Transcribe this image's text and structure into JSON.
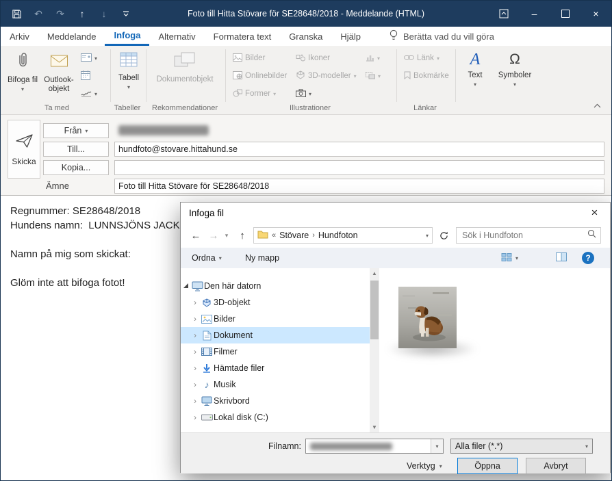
{
  "window": {
    "title": "Foto till Hitta Stövare för SE28648/2018 - Meddelande (HTML)"
  },
  "icons": {
    "dropdown": "▾",
    "undo": "↶",
    "redo": "↷",
    "prev_item": "↑",
    "next_item": "↓",
    "minimize": "–",
    "close": "×",
    "back": "←",
    "forward": "→",
    "up": "↑",
    "overflow": "«",
    "crumb_sep": "›",
    "tree_collapsed": "›",
    "music_note": "♪",
    "omega": "Ω",
    "text_a": "A",
    "help": "?"
  },
  "ribbon": {
    "tabs": [
      {
        "label": "Arkiv"
      },
      {
        "label": "Meddelande"
      },
      {
        "label": "Infoga"
      },
      {
        "label": "Alternativ"
      },
      {
        "label": "Formatera text"
      },
      {
        "label": "Granska"
      },
      {
        "label": "Hjälp"
      }
    ],
    "tell_me": "Berätta vad du vill göra",
    "groups": {
      "ta_med": "Ta med",
      "tabeller": "Tabeller",
      "rekommendationer": "Rekommendationer",
      "illustrationer": "Illustrationer",
      "lankar": "Länkar"
    },
    "buttons": {
      "bifoga_fil": "Bifoga fil",
      "outlook_objekt": "Outlook-objekt",
      "tabell": "Tabell",
      "dokumentobjekt": "Dokumentobjekt",
      "bilder": "Bilder",
      "onlinebilder": "Onlinebilder",
      "former": "Former",
      "ikoner": "Ikoner",
      "modeller_3d": "3D-modeller",
      "lank": "Länk",
      "bokmarke": "Bokmärke",
      "text": "Text",
      "symboler": "Symboler"
    }
  },
  "compose": {
    "send": "Skicka",
    "from_label": "Från",
    "to_label": "Till...",
    "cc_label": "Kopia...",
    "subject_label": "Ämne",
    "to_value": "hundfoto@stovare.hittahund.se",
    "cc_value": "",
    "subject_value": "Foto till Hitta Stövare för SE28648/2018",
    "body_lines": [
      "Regnummer: SE28648/2018",
      "Hundens namn:  LUNNSJÖNS JACK",
      "",
      "Namn på mig som skickat:",
      "",
      "Glöm inte att bifoga fotot!"
    ]
  },
  "dialog": {
    "title": "Infoga fil",
    "breadcrumb": {
      "items": [
        "Stövare",
        "Hundfoton"
      ]
    },
    "search_placeholder": "Sök i Hundfoton",
    "toolbar": {
      "organize": "Ordna",
      "new_folder": "Ny mapp"
    },
    "tree": [
      {
        "label": "Den här datorn"
      },
      {
        "label": "3D-objekt"
      },
      {
        "label": "Bilder"
      },
      {
        "label": "Dokument"
      },
      {
        "label": "Filmer"
      },
      {
        "label": "Hämtade filer"
      },
      {
        "label": "Musik"
      },
      {
        "label": "Skrivbord"
      },
      {
        "label": "Lokal disk (C:)"
      }
    ],
    "filename_label": "Filnamn:",
    "filetype_value": "Alla filer (*.*)",
    "tools": "Verktyg",
    "open": "Öppna",
    "cancel": "Avbryt"
  }
}
